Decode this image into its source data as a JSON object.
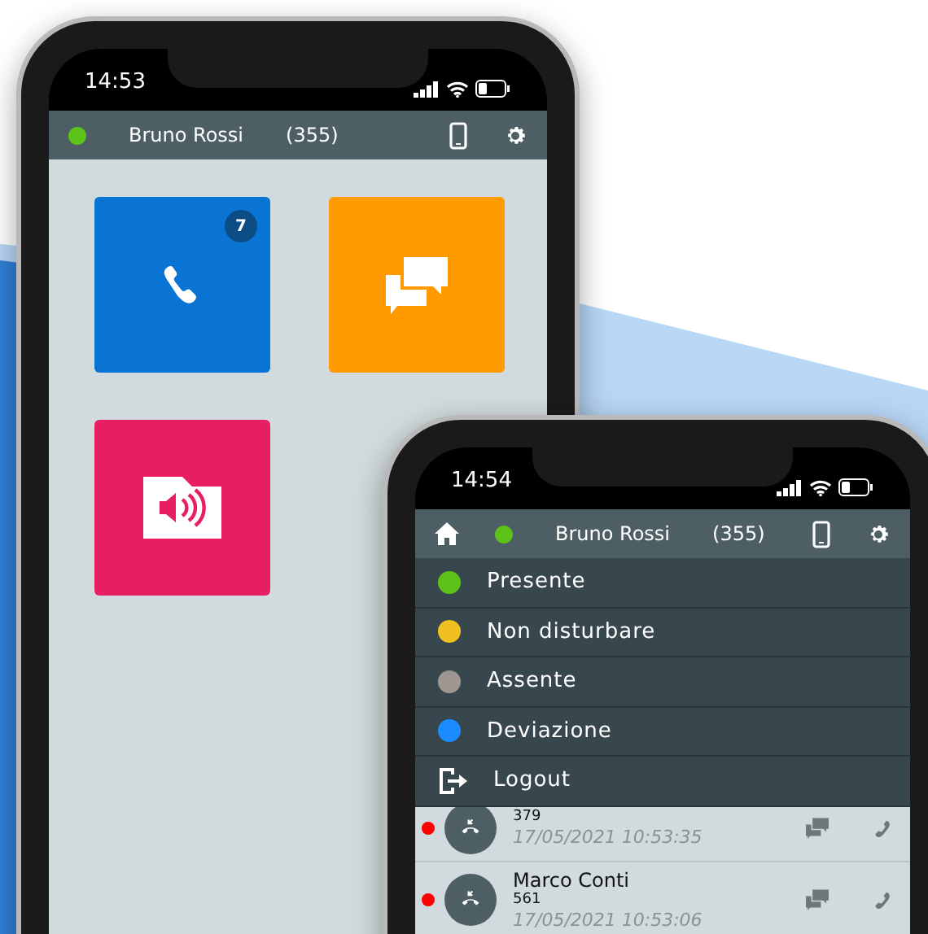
{
  "phones": [
    {
      "status_time": "14:53",
      "header": {
        "home": false,
        "presence": {
          "color": "#5cc21a"
        },
        "name": "Bruno Rossi",
        "extension": "(355)"
      },
      "tiles": [
        {
          "kind": "calls",
          "color": "#0a74d4",
          "badge": "7"
        },
        {
          "kind": "chat",
          "color": "#ff9a00"
        },
        {
          "kind": "voicemail",
          "color": "#e81e63"
        }
      ]
    },
    {
      "status_time": "14:54",
      "header": {
        "home": true,
        "presence": {
          "color": "#5cc21a"
        },
        "name": "Bruno Rossi",
        "extension": "(355)"
      },
      "menu": [
        {
          "kind": "status",
          "label": "Presente",
          "color": "#5cc21a"
        },
        {
          "kind": "status",
          "label": "Non disturbare",
          "color": "#f0c020"
        },
        {
          "kind": "status",
          "label": "Assente",
          "color": "#9e9690"
        },
        {
          "kind": "status",
          "label": "Deviazione",
          "color": "#1a8cff"
        },
        {
          "kind": "logout",
          "label": "Logout"
        }
      ],
      "calls": [
        {
          "number": "379",
          "time": "17/05/2021 10:53:35",
          "color": "#ff0000"
        },
        {
          "name": "Marco Conti",
          "number": "561",
          "time": "17/05/2021 10:53:06",
          "color": "#ff0000"
        }
      ]
    }
  ]
}
